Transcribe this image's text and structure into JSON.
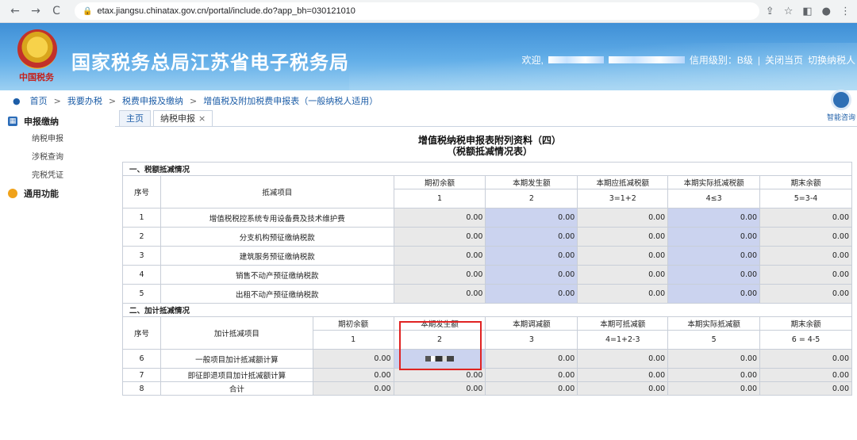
{
  "browser": {
    "url": "etax.jiangsu.chinatax.gov.cn/portal/include.do?app_bh=030121010",
    "back_icon": "←",
    "forward_icon": "→",
    "reload_icon": "C",
    "lock_icon": "🔒",
    "right_icons": [
      "⇪",
      "☆",
      "◧",
      "●",
      "⋮"
    ]
  },
  "header": {
    "emblem_caption": "中国税务",
    "title": "国家税务总局江苏省电子税务局",
    "welcome": "欢迎,",
    "credit_level": "信用级别：B级",
    "close_page": "关闭当页",
    "switch_taxpayer": "切换纳税人"
  },
  "breadcrumb": [
    "首页",
    "我要办税",
    "税费申报及缴纳",
    "增值税及附加税费申报表（一般纳税人适用）"
  ],
  "sidebar": {
    "group1": "申报缴纳",
    "items": [
      "纳税申报",
      "涉税查询",
      "完税凭证"
    ],
    "group2": "通用功能"
  },
  "tabs": [
    {
      "label": "主页"
    },
    {
      "label": "纳税申报",
      "close": "×"
    }
  ],
  "helper_label": "智能咨询",
  "form": {
    "title": "增值税纳税申报表附列资料（四）",
    "subtitle": "（税额抵减情况表）",
    "sec1": {
      "heading": "一、税额抵减情况",
      "col_seq": "序号",
      "col_item": "抵减项目",
      "cols": [
        "期初余额",
        "本期发生额",
        "本期应抵减税额",
        "本期实际抵减税额",
        "期末余额"
      ],
      "col_codes": [
        "1",
        "2",
        "3=1+2",
        "4≤3",
        "5=3-4"
      ],
      "rows": [
        {
          "seq": "1",
          "item": "增值税税控系统专用设备费及技术维护费",
          "v": [
            "0.00",
            "0.00",
            "0.00",
            "0.00",
            "0.00"
          ]
        },
        {
          "seq": "2",
          "item": "分支机构预征缴纳税款",
          "v": [
            "0.00",
            "0.00",
            "0.00",
            "0.00",
            "0.00"
          ]
        },
        {
          "seq": "3",
          "item": "建筑服务预征缴纳税款",
          "v": [
            "0.00",
            "0.00",
            "0.00",
            "0.00",
            "0.00"
          ]
        },
        {
          "seq": "4",
          "item": "销售不动产预征缴纳税款",
          "v": [
            "0.00",
            "0.00",
            "0.00",
            "0.00",
            "0.00"
          ]
        },
        {
          "seq": "5",
          "item": "出租不动产预征缴纳税款",
          "v": [
            "0.00",
            "0.00",
            "0.00",
            "0.00",
            "0.00"
          ]
        }
      ]
    },
    "sec2": {
      "heading": "二、加计抵减情况",
      "col_seq": "序号",
      "col_item": "加计抵减项目",
      "cols": [
        "期初余额",
        "本期发生额",
        "本期调减额",
        "本期可抵减额",
        "本期实际抵减额",
        "期末余额"
      ],
      "col_codes": [
        "1",
        "2",
        "3",
        "4=1+2-3",
        "5",
        "6 = 4-5"
      ],
      "rows": [
        {
          "seq": "6",
          "item": "一般项目加计抵减额计算",
          "v": [
            "0.00",
            "",
            "0.00",
            "0.00",
            "0.00",
            "0.00"
          ]
        },
        {
          "seq": "7",
          "item": "即征即退项目加计抵减额计算",
          "v": [
            "0.00",
            "0.00",
            "0.00",
            "0.00",
            "0.00",
            "0.00"
          ]
        },
        {
          "seq": "8",
          "item": "合计",
          "v": [
            "0.00",
            "0.00",
            "0.00",
            "0.00",
            "0.00",
            "0.00"
          ]
        }
      ]
    }
  }
}
